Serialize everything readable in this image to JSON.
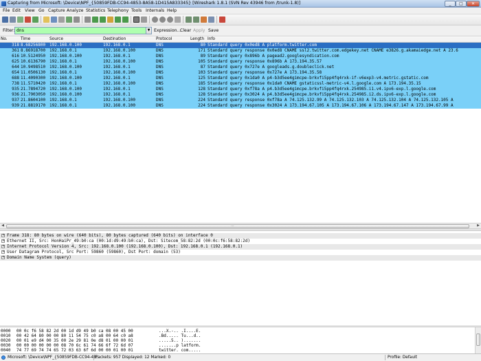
{
  "window": {
    "title": "Capturing from Microsoft: \\Device\\NPF_{50859FDB-CC94-4853-8A58-1D415A833345}   [Wireshark 1.8.1  (SVN Rev 43946 from /trunk-1.8)]",
    "min_label": "_",
    "max_label": "□",
    "close_label": "✕"
  },
  "menu": [
    "File",
    "Edit",
    "View",
    "Go",
    "Capture",
    "Analyze",
    "Statistics",
    "Telephony",
    "Tools",
    "Internals",
    "Help"
  ],
  "toolbar": {
    "icons": [
      "interface-list-icon",
      "capture-options-icon",
      "start-capture-icon",
      "stop-capture-icon",
      "restart-capture-icon",
      "open-file-icon",
      "save-file-icon",
      "close-file-icon",
      "reload-icon",
      "print-icon",
      "find-packet-icon",
      "go-back-icon",
      "go-forward-icon",
      "go-to-packet-icon",
      "go-first-icon",
      "go-last-icon",
      "colorize-icon",
      "auto-scroll-icon",
      "zoom-in-icon",
      "zoom-out-icon",
      "normal-size-icon",
      "resize-columns-icon",
      "capture-filters-icon",
      "display-filters-icon",
      "coloring-rules-icon",
      "preferences-icon",
      "help-icon"
    ]
  },
  "filter": {
    "label": "Filter:",
    "value": "dns",
    "expression": "Expression...",
    "clear": "Clear",
    "apply": "Apply",
    "save": "Save"
  },
  "columns": [
    "No.",
    "Time",
    "Source",
    "Destination",
    "Protocol",
    "Length",
    "Info"
  ],
  "packets": [
    {
      "no": "318",
      "time": "8.68256800",
      "src": "192.168.0.100",
      "dst": "192.168.0.1",
      "proto": "DNS",
      "len": "80",
      "info": "Standard query 0x0ed8  A platform.twitter.com",
      "selected": true
    },
    {
      "no": "361",
      "time": "8.86918700",
      "src": "192.168.0.1",
      "dst": "192.168.0.100",
      "proto": "DNS",
      "len": "171",
      "info": "Standard query response 0x0ed8  CNAME ssl2.twitter.com.edgekey.net CNAME e3826.g.akamaiedge.net A 23.6",
      "selected": false
    },
    {
      "no": "616",
      "time": "10.5124950",
      "src": "192.168.0.100",
      "dst": "192.168.0.1",
      "proto": "DNS",
      "len": "89",
      "info": "Standard query 0x896b  A pagead2.googlesyndication.com",
      "selected": false
    },
    {
      "no": "625",
      "time": "10.6136790",
      "src": "192.168.0.1",
      "dst": "192.168.0.100",
      "proto": "DNS",
      "len": "105",
      "info": "Standard query response 0x896b  A 173.194.35.57",
      "selected": false
    },
    {
      "no": "644",
      "time": "10.9498510",
      "src": "192.168.0.100",
      "dst": "192.168.0.1",
      "proto": "DNS",
      "len": "87",
      "info": "Standard query 0x727e  A googleads.g.doubleclick.net",
      "selected": false
    },
    {
      "no": "654",
      "time": "11.0506130",
      "src": "192.168.0.1",
      "dst": "192.168.0.100",
      "proto": "DNS",
      "len": "103",
      "info": "Standard query response 0x727e  A 173.194.35.58",
      "selected": false
    },
    {
      "no": "688",
      "time": "11.4090300",
      "src": "192.168.0.100",
      "dst": "192.168.0.1",
      "proto": "DNS",
      "len": "125",
      "info": "Standard query 0x1da0  A p4-b3d5ee4gimcpe-brkvfi5pp4fq4rxk-if-v6exp3-v4.metric.gstatic.com",
      "selected": false
    },
    {
      "no": "738",
      "time": "11.5710420",
      "src": "192.168.0.1",
      "dst": "192.168.0.100",
      "proto": "DNS",
      "len": "185",
      "info": "Standard query response 0x1da0  CNAME gstaticssl-metric-v4.l.google.com A 173.194.35.15",
      "selected": false
    },
    {
      "no": "935",
      "time": "21.7894720",
      "src": "192.168.0.100",
      "dst": "192.168.0.1",
      "proto": "DNS",
      "len": "128",
      "info": "Standard query 0xf78a  A p4.b3d5ee4gimcpe.brkvfi5pp4fq4rxk.254985.i1.v4.ipv6-exp.l.google.com",
      "selected": false
    },
    {
      "no": "936",
      "time": "21.7903050",
      "src": "192.168.0.100",
      "dst": "192.168.0.1",
      "proto": "DNS",
      "len": "128",
      "info": "Standard query 0x3024  A p4.b3d5ee4gimcpe.brkvfi5pp4fq4rxk.254985.i2.ds.ipv6-exp.l.google.com",
      "selected": false
    },
    {
      "no": "937",
      "time": "21.8604100",
      "src": "192.168.0.1",
      "dst": "192.168.0.100",
      "proto": "DNS",
      "len": "224",
      "info": "Standard query response 0xf78a  A 74.125.132.99 A 74.125.132.103 A 74.125.132.104 A 74.125.132.105 A",
      "selected": false
    },
    {
      "no": "939",
      "time": "21.8819170",
      "src": "192.168.0.1",
      "dst": "192.168.0.100",
      "proto": "DNS",
      "len": "224",
      "info": "Standard query response 0x3024  A 173.194.67.105 A 173.194.67.106 A 173.194.67.147 A 173.194.67.99 A",
      "selected": false
    }
  ],
  "details": [
    {
      "text": "Frame 318: 80 bytes on wire (640 bits), 80 bytes captured (640 bits) on interface 0"
    },
    {
      "text": "Ethernet II, Src: HonHaiPr_49:b0:ca (00:1d:d9:49:b0:ca), Dst: Sitecom_58:82:2d (00:0c:f6:58:82:2d)"
    },
    {
      "text": "Internet Protocol Version 4, Src: 192.168.0.100 (192.168.0.100), Dst: 192.168.0.1 (192.168.0.1)"
    },
    {
      "text": "User Datagram Protocol, Src Port: 59860 (59860), Dst Port: domain (53)"
    },
    {
      "text": "Domain Name System (query)"
    }
  ],
  "bytes": [
    {
      "off": "0000",
      "hex": "00 0c f6 58 82 2d 00 1d  d9 49 b0 ca 08 00 45 00",
      "asc": "...X.-.. .I....E."
    },
    {
      "off": "0010",
      "hex": "00 42 64 80 00 00 80 11  54 75 c0 a8 00 64 c0 a8",
      "asc": ".Bd..... Tu...d.."
    },
    {
      "off": "0020",
      "hex": "00 01 e9 d4 00 35 00 2e  29 81 0e d8 01 00 00 01",
      "asc": ".....5.. ).......  "
    },
    {
      "off": "0030",
      "hex": "00 00 00 00 00 00 08 70  6c 61 74 66 6f 72 6d 07",
      "asc": ".......p latform."
    },
    {
      "off": "0040",
      "hex": "74 77 69 74 74 65 72 03  63 6f 6d 00 00 01 00 01",
      "asc": "twitter. com....."
    }
  ],
  "status": {
    "interface": "Microsoft: \\Device\\NPF_{50859FDB-CC94-4B...",
    "packets": "Packets: 957 Displayed: 12 Marked: 0",
    "profile": "Profile: Default"
  },
  "colors": {
    "row_bg": "#7ad0f8",
    "row_selected": "#2a6ec3",
    "filter_valid": "#afffaf"
  }
}
